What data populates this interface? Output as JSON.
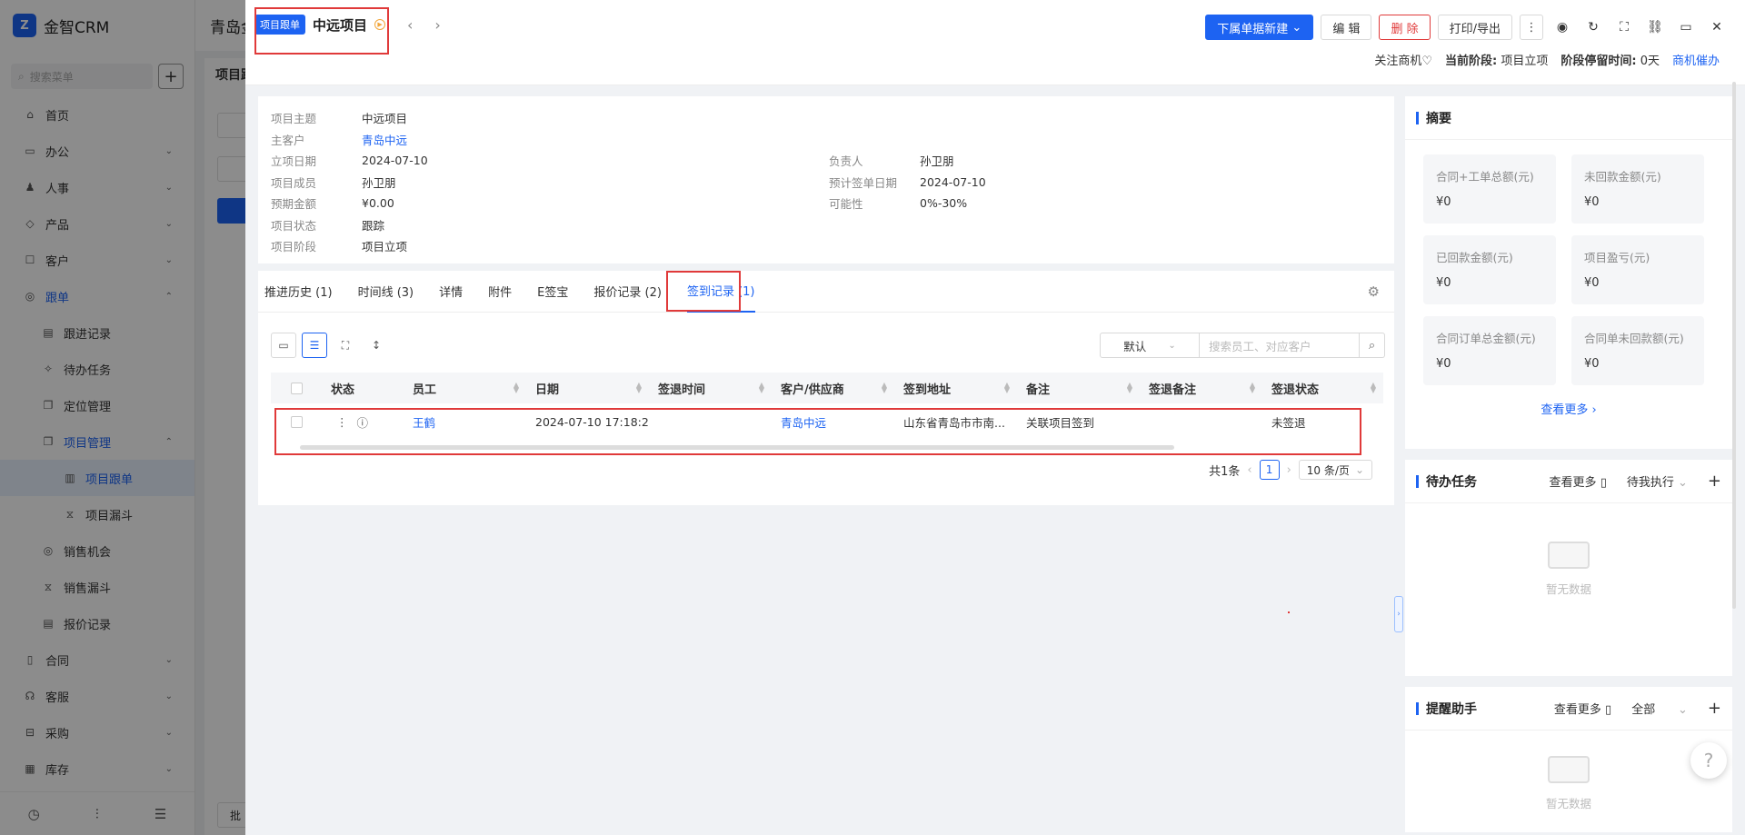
{
  "app": {
    "brand": "金智CRM",
    "search_placeholder": "搜索菜单",
    "header_title": "青岛金",
    "page_title": "项目跟"
  },
  "sidebar": {
    "items": [
      {
        "label": "首页",
        "icon": "home-icon"
      },
      {
        "label": "办公",
        "icon": "briefcase-icon"
      },
      {
        "label": "人事",
        "icon": "people-icon"
      },
      {
        "label": "产品",
        "icon": "box-icon"
      },
      {
        "label": "客户",
        "icon": "customer-icon"
      },
      {
        "label": "跟单",
        "icon": "follow-icon"
      },
      {
        "label": "跟进记录",
        "icon": "record-icon"
      },
      {
        "label": "待办任务",
        "icon": "pin-icon"
      },
      {
        "label": "定位管理",
        "icon": "location-icon"
      },
      {
        "label": "项目管理",
        "icon": "project-icon"
      },
      {
        "label": "项目跟单",
        "icon": "doc-icon"
      },
      {
        "label": "项目漏斗",
        "icon": "funnel-icon"
      },
      {
        "label": "销售机会",
        "icon": "opportunity-icon"
      },
      {
        "label": "销售漏斗",
        "icon": "funnel-icon"
      },
      {
        "label": "报价记录",
        "icon": "quote-icon"
      },
      {
        "label": "合同",
        "icon": "contract-icon"
      },
      {
        "label": "客服",
        "icon": "service-icon"
      },
      {
        "label": "采购",
        "icon": "purchase-icon"
      },
      {
        "label": "库存",
        "icon": "stock-icon"
      }
    ],
    "footer_btn": "批"
  },
  "drawer": {
    "doc_tag": "项目跟单",
    "project_name": "中远项目",
    "actions": {
      "new_sub": "下属单据新建",
      "edit": "编 辑",
      "delete": "删 除",
      "print": "打印/导出"
    },
    "status": {
      "follow": "关注商机",
      "stage_label": "当前阶段:",
      "stage_value": "项目立项",
      "stay_label": "阶段停留时间:",
      "stay_value": "0天",
      "remind": "商机催办"
    },
    "info_left": [
      {
        "k": "项目主题",
        "v": "中远项目"
      },
      {
        "k": "主客户",
        "v": "青岛中远"
      },
      {
        "k": "立项日期",
        "v": "2024-07-10"
      },
      {
        "k": "项目成员",
        "v": "孙卫朋"
      },
      {
        "k": "预期金额",
        "v": "¥0.00"
      },
      {
        "k": "项目状态",
        "v": "跟踪"
      },
      {
        "k": "项目阶段",
        "v": "项目立项"
      }
    ],
    "info_right": [
      {
        "k": "负责人",
        "v": "孙卫朋"
      },
      {
        "k": "预计签单日期",
        "v": "2024-07-10"
      },
      {
        "k": "可能性",
        "v": "0%-30%"
      }
    ],
    "tabs": [
      "推进历史 (1)",
      "时间线 (3)",
      "详情",
      "附件",
      "E签宝",
      "报价记录 (2)",
      "签到记录 (1)"
    ],
    "search": {
      "select": "默认",
      "placeholder": "搜索员工、对应客户"
    },
    "table": {
      "columns": [
        "状态",
        "员工",
        "日期",
        "签退时间",
        "客户/供应商",
        "签到地址",
        "备注",
        "签退备注",
        "签退状态"
      ],
      "rows": [
        {
          "employee": "王鹤",
          "date": "2024-07-10 17:18:26",
          "checkout_time": "",
          "customer": "青岛中远",
          "address": "山东省青岛市市南...",
          "remark": "关联项目签到",
          "checkout_remark": "",
          "checkout_status": "未签退"
        }
      ]
    },
    "pager": {
      "total": "共1条",
      "page": "1",
      "size": "10 条/页"
    }
  },
  "summary": {
    "title": "摘要",
    "stats": [
      {
        "label": "合同+工单总额(元)",
        "value": "¥0"
      },
      {
        "label": "未回款金额(元)",
        "value": "¥0"
      },
      {
        "label": "已回款金额(元)",
        "value": "¥0"
      },
      {
        "label": "项目盈亏(元)",
        "value": "¥0"
      },
      {
        "label": "合同订单总金额(元)",
        "value": "¥0"
      },
      {
        "label": "合同单未回款额(元)",
        "value": "¥0"
      }
    ],
    "more": "查看更多"
  },
  "todo": {
    "title": "待办任务",
    "more": "查看更多",
    "filter": "待我执行",
    "empty": "暂无数据"
  },
  "reminder": {
    "title": "提醒助手",
    "more": "查看更多",
    "filter": "全部",
    "empty": "暂无数据"
  },
  "colors": {
    "primary": "#1d63f2",
    "danger": "#e03a3a",
    "highlight": "#e03a3a"
  }
}
